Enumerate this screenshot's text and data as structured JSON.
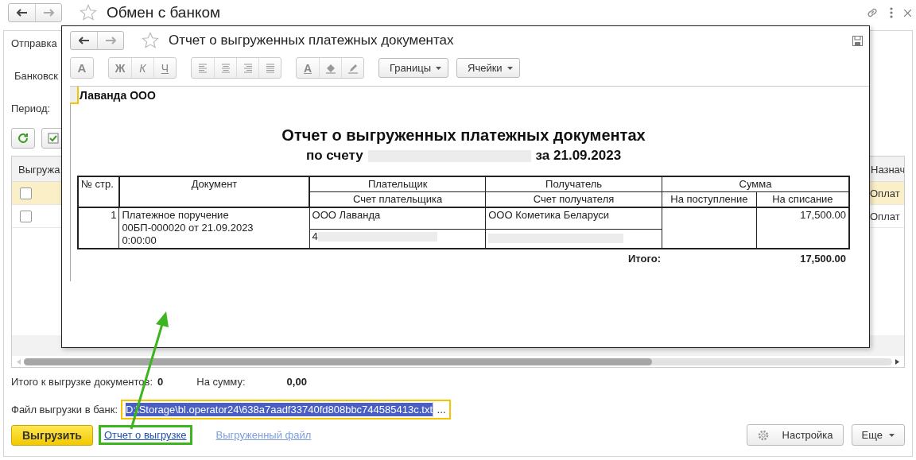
{
  "window": {
    "title": "Обмен с банком"
  },
  "form": {
    "tab": "Отправка",
    "bank_label": "Банковск",
    "period_label": "Период:"
  },
  "table": {
    "columns": [
      "Выгружа",
      "Назнач"
    ],
    "rows": [
      {
        "selected": true,
        "checked": false,
        "purpose": "Оплат"
      },
      {
        "selected": false,
        "checked": false,
        "purpose": "Оплат"
      }
    ]
  },
  "totals": {
    "count_label": "Итого к выгрузке документов:",
    "count": "0",
    "sum_label": "На сумму:",
    "sum": "0,00"
  },
  "file": {
    "label": "Файл выгрузки в банк:",
    "value": "D:\\Storage\\bl.operator24\\638a7aadf33740fd808bbc744585413c.txt",
    "button": "..."
  },
  "actions": {
    "upload": "Выгрузить",
    "report_link": "Отчет о выгрузке",
    "file_link": "Выгруженный файл",
    "settings": "Настройка",
    "more": "Еще"
  },
  "report_window": {
    "title": "Отчет о выгруженных платежных документах",
    "toolbar": {
      "font": "A",
      "styles": [
        {
          "kind": "bold",
          "label": "Ж"
        },
        {
          "kind": "italic",
          "label": "К"
        },
        {
          "kind": "underline",
          "label": "Ч"
        }
      ],
      "text_color": "A",
      "menus": [
        "Границы",
        "Ячейки"
      ]
    }
  },
  "report": {
    "company": "Лаванда ООО",
    "title": "Отчет о выгруженных платежных документах",
    "account_prefix": "по счету",
    "account_suffix": "за 21.09.2023",
    "headers": {
      "num": "№ стр.",
      "document": "Документ",
      "payer": "Плательщик",
      "receiver": "Получатель",
      "sum": "Сумма",
      "payer_account": "Счет плательщика",
      "receiver_account": "Счет получателя",
      "incoming": "На поступление",
      "outgoing": "На списание"
    },
    "rows": [
      {
        "num": "1",
        "document": "Платежное поручение\n00БП-000020 от 21.09.2023\n0:00:00",
        "payer": "ООО Лаванда",
        "payer_account": "4",
        "receiver": "ООО Кометика Беларуси",
        "outgoing": "17,500.00"
      }
    ],
    "total_label": "Итого:",
    "total": "17,500.00"
  }
}
